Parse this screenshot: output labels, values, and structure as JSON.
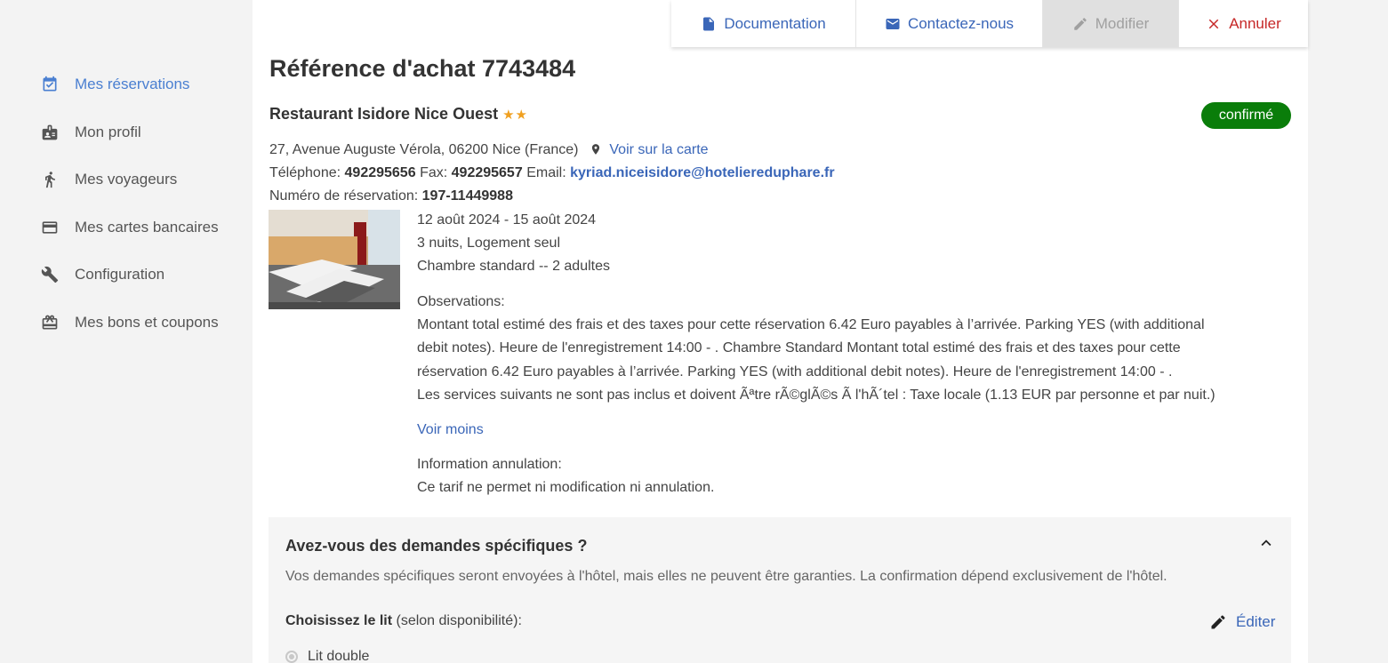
{
  "sidebar": {
    "items": [
      {
        "label": "Mes réservations",
        "icon": "calendar-check-icon",
        "active": true
      },
      {
        "label": "Mon profil",
        "icon": "id-card-icon"
      },
      {
        "label": "Mes voyageurs",
        "icon": "walking-person-icon"
      },
      {
        "label": "Mes cartes bancaires",
        "icon": "credit-card-icon"
      },
      {
        "label": "Configuration",
        "icon": "tools-icon"
      },
      {
        "label": "Mes bons et coupons",
        "icon": "gift-card-icon"
      }
    ]
  },
  "actions": {
    "documentation": "Documentation",
    "contact": "Contactez-nous",
    "modify": "Modifier",
    "cancel": "Annuler"
  },
  "booking": {
    "title": "Référence d'achat 7743484",
    "hotel_name": "Restaurant Isidore Nice Ouest",
    "stars": "★★",
    "status": "confirmé",
    "address": "27, Avenue Auguste Vérola, 06200 Nice (France)",
    "map_link": "Voir sur la carte",
    "phone_label": "Téléphone:",
    "phone": "492295656",
    "fax_label": "Fax:",
    "fax": "492295657",
    "email_label": "Email:",
    "email": "kyriad.niceisidore@hoteliereduphare.fr",
    "reservation_label": "Numéro de réservation:",
    "reservation_number": "197-11449988",
    "dates": "12 août 2024 - 15 août 2024",
    "nights": "3 nuits, Logement seul",
    "room": "Chambre standard -- 2 adultes",
    "observations_title": "Observations:",
    "observations_line1": "Montant total estimé des frais et des taxes pour cette réservation 6.42 Euro payables à l’arrivée. Parking YES (with additional",
    "observations_line2": "debit notes). Heure de l'enregistrement 14:00 - . Chambre Standard Montant total estimé des frais et des taxes pour cette",
    "observations_line3": "réservation 6.42 Euro payables à l’arrivée. Parking YES (with additional debit notes). Heure de l'enregistrement 14:00 - .",
    "observations_line4": "Les services suivants ne sont pas inclus et doivent Ãªtre rÃ©glÃ©s Ã l'hÃ´tel : Taxe locale (1.13 EUR par personne et par nuit.)",
    "see_less": "Voir moins",
    "cancellation_title": "Information annulation:",
    "cancellation_text": "Ce tarif ne permet ni modification ni annulation."
  },
  "requests": {
    "title": "Avez-vous des demandes spécifiques ?",
    "description": "Vos demandes spécifiques seront envoyées à l'hôtel, mais elles ne peuvent être garanties. La confirmation dépend exclusivement de l'hôtel.",
    "bed_label": "Choisissez le lit",
    "bed_hint": "(selon disponibilité):",
    "edit": "Éditer",
    "bed_option": "Lit double"
  },
  "colors": {
    "accent": "#4a7fd1",
    "link": "#3a66b8",
    "cancel": "#c62828",
    "status": "#0a7d0a",
    "star": "#f0a020"
  }
}
